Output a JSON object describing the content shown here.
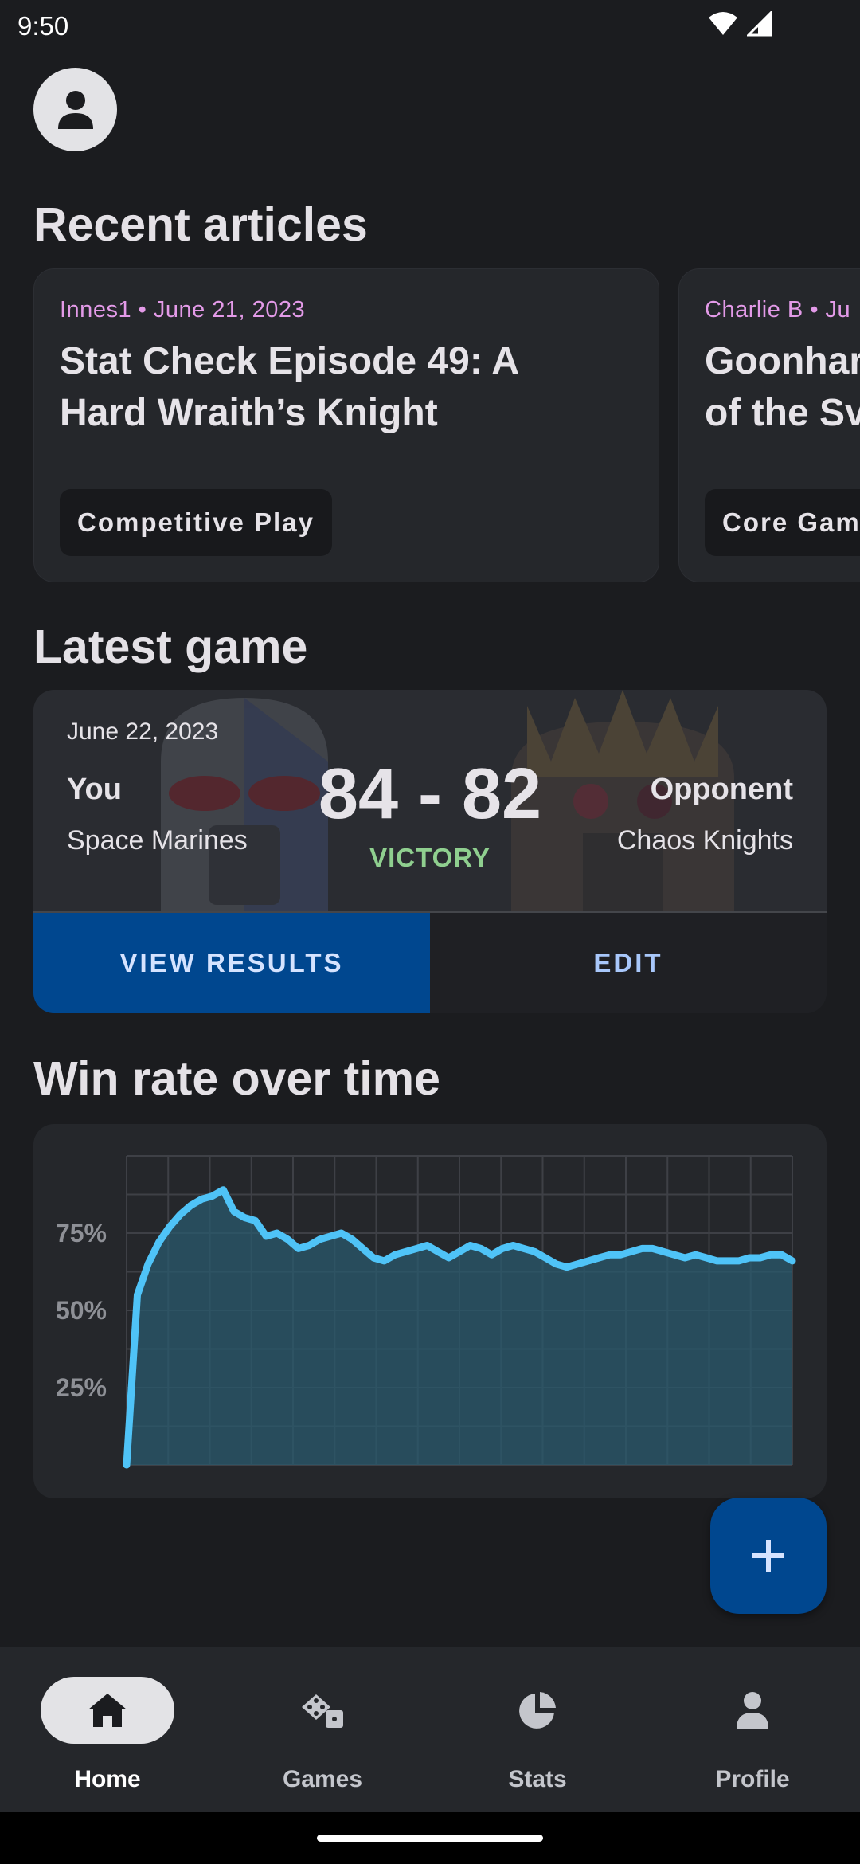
{
  "status_bar": {
    "time": "9:50"
  },
  "sections": {
    "articles_title": "Recent articles",
    "latest_game_title": "Latest game",
    "win_rate_title": "Win rate over time"
  },
  "articles": [
    {
      "meta": "Innes1 • June 21, 2023",
      "title": "Stat Check Episode 49: A\nHard Wraith’s Knight",
      "tag": "Competitive Play"
    },
    {
      "meta": "Charlie B • Ju",
      "title": "Goonhar\nof the Sv",
      "tag": "Core Gam"
    }
  ],
  "latest_game": {
    "date": "June 22, 2023",
    "you_label": "You",
    "you_faction": "Space Marines",
    "score": "84 - 82",
    "result": "VICTORY",
    "opponent_label": "Opponent",
    "opponent_faction": "Chaos Knights",
    "view_results_label": "VIEW RESULTS",
    "edit_label": "EDIT"
  },
  "chart_data": {
    "type": "area",
    "title": "Win rate over time",
    "yticks": [
      "75%",
      "50%",
      "25%"
    ],
    "ylim": [
      0,
      100
    ],
    "grid": true,
    "line_color": "#4fc3f7",
    "fill_color": "#2a5a6e",
    "values": [
      0,
      55,
      65,
      72,
      77,
      81,
      84,
      86,
      87,
      89,
      82,
      80,
      79,
      74,
      75,
      73,
      70,
      71,
      73,
      74,
      75,
      73,
      70,
      67,
      66,
      68,
      69,
      70,
      71,
      69,
      67,
      69,
      71,
      70,
      68,
      70,
      71,
      70,
      69,
      67,
      65,
      64,
      65,
      66,
      67,
      68,
      68,
      69,
      70,
      70,
      69,
      68,
      67,
      68,
      67,
      66,
      66,
      66,
      67,
      67,
      68,
      68,
      66
    ]
  },
  "fab": {
    "icon": "plus-icon"
  },
  "bottom_nav": [
    {
      "label": "Home",
      "icon": "home-icon",
      "active": true
    },
    {
      "label": "Games",
      "icon": "dice-icon",
      "active": false
    },
    {
      "label": "Stats",
      "icon": "pie-chart-icon",
      "active": false
    },
    {
      "label": "Profile",
      "icon": "person-icon",
      "active": false
    }
  ],
  "colors": {
    "background": "#1b1c1f",
    "card": "#25272b",
    "primary_button": "#00478f",
    "accent_pink": "#e39ae8",
    "victory_green": "#8fcf8f",
    "edit_blue": "#a8c7fa"
  }
}
